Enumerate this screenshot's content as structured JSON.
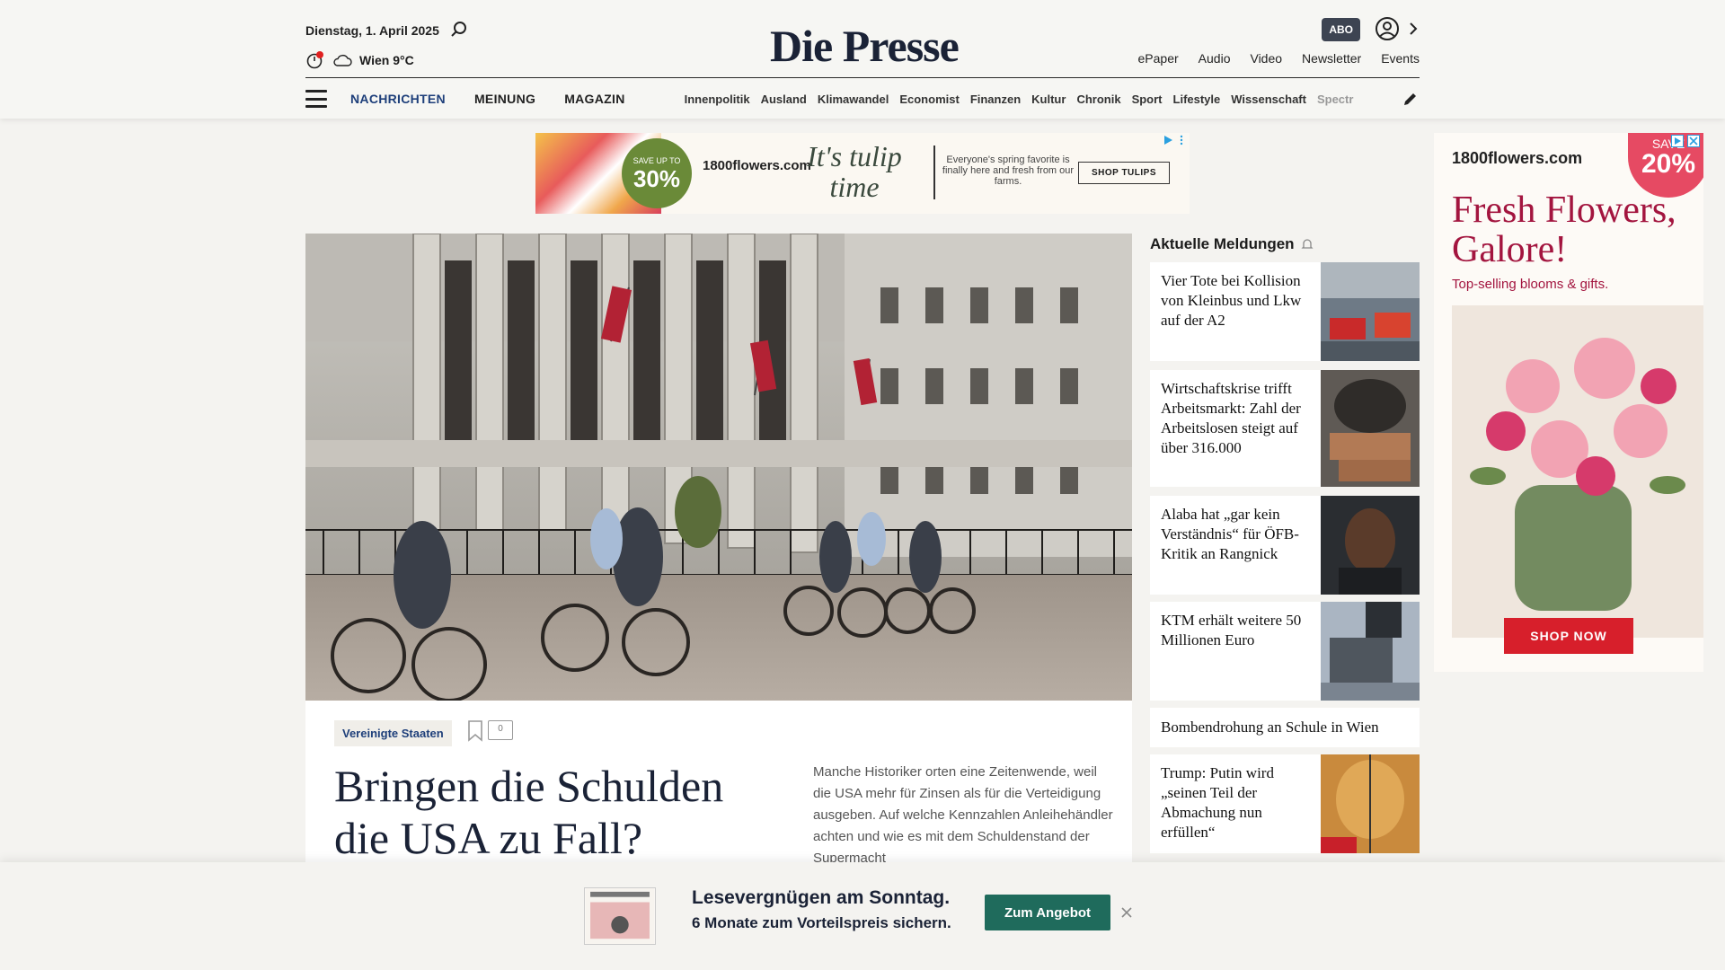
{
  "header": {
    "date": "Dienstag, 1. April 2025",
    "weather": "Wien 9°C",
    "logo": "Die Presse",
    "abo": "ABO",
    "utils": [
      "ePaper",
      "Audio",
      "Video",
      "Newsletter",
      "Events"
    ]
  },
  "nav": {
    "main": [
      "NACHRICHTEN",
      "MEINUNG",
      "MAGAZIN"
    ],
    "sub": [
      "Innenpolitik",
      "Ausland",
      "Klimawandel",
      "Economist",
      "Finanzen",
      "Kultur",
      "Chronik",
      "Sport",
      "Lifestyle",
      "Wissenschaft",
      "Spectr"
    ]
  },
  "top_ad": {
    "save_small": "SAVE UP TO",
    "save_big": "30%",
    "brand": "1800flowers.com",
    "slogan": "It's tulip time",
    "desc": "Everyone's spring favorite is finally here and fresh from our farms.",
    "cta": "SHOP TULIPS"
  },
  "article": {
    "tag": "Vereinigte Staaten",
    "comments": "0",
    "headline": "Bringen die Schulden die USA zu Fall?",
    "teaser": "Manche Historiker orten eine Zeitenwende, weil die USA mehr für Zinsen als für die Verteidigung ausgeben. Auf welche Kennzahlen Anleihehändler achten und wie es mit dem Schuldenstand der Supermacht"
  },
  "sidebar": {
    "title": "Aktuelle Meldungen",
    "items": [
      {
        "text": "Vier Tote bei Kollision von Kleinbus und Lkw auf der A2"
      },
      {
        "text": "Wirtschaftskrise trifft Arbeitsmarkt: Zahl der Arbeitslosen steigt auf über 316.000"
      },
      {
        "text": "Alaba hat „gar kein Verständnis“ für ÖFB-Kritik an Rangnick"
      },
      {
        "text": "KTM erhält weitere 50 Millionen Euro"
      },
      {
        "text": "Bombendrohung an Schule in Wien"
      },
      {
        "text": "Trump: Putin wird „seinen Teil der Abmachung nun erfüllen“"
      }
    ]
  },
  "right_ad": {
    "brand": "1800flowers.com",
    "badge_small": "SAVE",
    "badge_big": "20%",
    "headline": "Fresh Flowers, Galore!",
    "sub": "Top-selling blooms & gifts.",
    "cta": "SHOP NOW"
  },
  "promo": {
    "title": "Lesevergnügen am Sonntag.",
    "sub": "6 Monate zum Vorteilspreis sichern.",
    "cta": "Zum Angebot"
  },
  "colors": {
    "brand_navy": "#1a2236",
    "nav_active": "#1e3f7a",
    "promo_button": "#1f6b5c",
    "ad_red": "#d71f2b"
  }
}
